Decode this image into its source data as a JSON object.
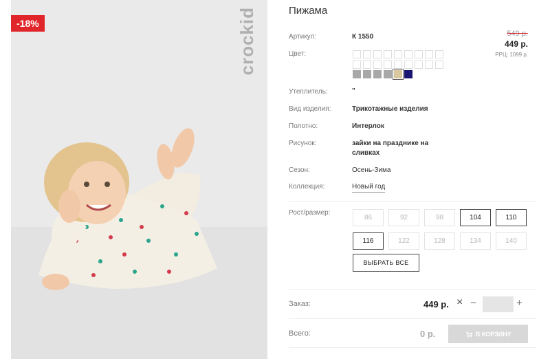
{
  "photo": {
    "discount_badge": "-18%",
    "brand": "crockid"
  },
  "product": {
    "title": "Пижама",
    "price_old": "549 р.",
    "price_new": "449 р.",
    "price_rrc": "РРЦ: 1099 р."
  },
  "attributes": {
    "article_label": "Артикул:",
    "article_value": "К 1550",
    "color_label": "Цвет:",
    "filler_label": "Утеплитель:",
    "filler_value": "\"",
    "type_label": "Вид изделия:",
    "type_value": "Трикотажные изделия",
    "fabric_label": "Полотно:",
    "fabric_value": "Интерлок",
    "print_label": "Рисунок:",
    "print_value": "зайки на празднике на сливках",
    "season_label": "Сезон:",
    "season_value": "Осень-Зима",
    "collection_label": "Коллекция:",
    "collection_value": "Новый год"
  },
  "colors": {
    "chips": [
      "#a8a8a8",
      "#a8a8a8",
      "#a8a8a8",
      "#a8a8a8",
      "#d9c8a0",
      "#1a1570"
    ],
    "selected_index": 4
  },
  "sizes": {
    "label": "Рост/размер:",
    "options": [
      {
        "label": "86",
        "active": false
      },
      {
        "label": "92",
        "active": false
      },
      {
        "label": "98",
        "active": false
      },
      {
        "label": "104",
        "active": true
      },
      {
        "label": "110",
        "active": true
      },
      {
        "label": "116",
        "active": true
      },
      {
        "label": "122",
        "active": false
      },
      {
        "label": "128",
        "active": false
      },
      {
        "label": "134",
        "active": false
      },
      {
        "label": "140",
        "active": false
      }
    ],
    "select_all": "ВЫБРАТЬ ВСЕ"
  },
  "order": {
    "label": "Заказ:",
    "price": "449 р.",
    "times": "×",
    "minus": "−",
    "plus": "+",
    "quantity": ""
  },
  "total": {
    "label": "Всего:",
    "value": "0 р.",
    "cart_button": "В КОРЗИНУ"
  }
}
